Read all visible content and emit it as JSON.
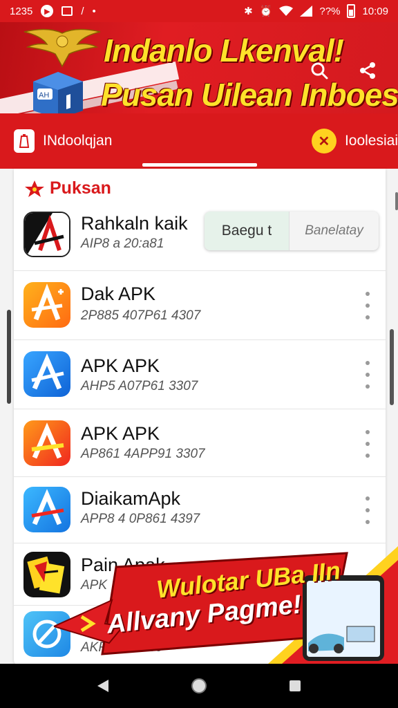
{
  "status_bar": {
    "time_left": "1235",
    "battery_text": "??%",
    "clock": "10:09"
  },
  "header": {
    "title_line1": "Indanlo Lkenval!",
    "title_line2": "Pusan Uilean Inboesia!",
    "mascot_label": "AH"
  },
  "tabs": [
    {
      "label": "INdoolqjan"
    },
    {
      "label": "Ioolesiai"
    }
  ],
  "section": {
    "title": "Puksan"
  },
  "featured": {
    "name": "Rahkaln kaik",
    "meta": "AIP8 a 20:a81",
    "toggle_primary": "Baegu t",
    "toggle_secondary": "Banelatay"
  },
  "apps": [
    {
      "name": "Dak APK",
      "meta": "2P885 407P61 4307"
    },
    {
      "name": "APK APK",
      "meta": "AHP5 A07P61 3307"
    },
    {
      "name": "APK APK",
      "meta": "AP861 4APP91 3307"
    },
    {
      "name": "DiaikamApk",
      "meta": "APP8 4 0P861 4397"
    },
    {
      "name": "Pain Apak",
      "meta": "APK"
    },
    {
      "name": "",
      "meta": "AKRh 306b60"
    }
  ],
  "promo": {
    "line1": "Wulotar UBa IIn",
    "line2": "Allvany Pagme!"
  },
  "colors": {
    "brand_red": "#d9191c",
    "accent_yellow": "#ffe22a",
    "toggle_bg": "#e6f2ea"
  }
}
